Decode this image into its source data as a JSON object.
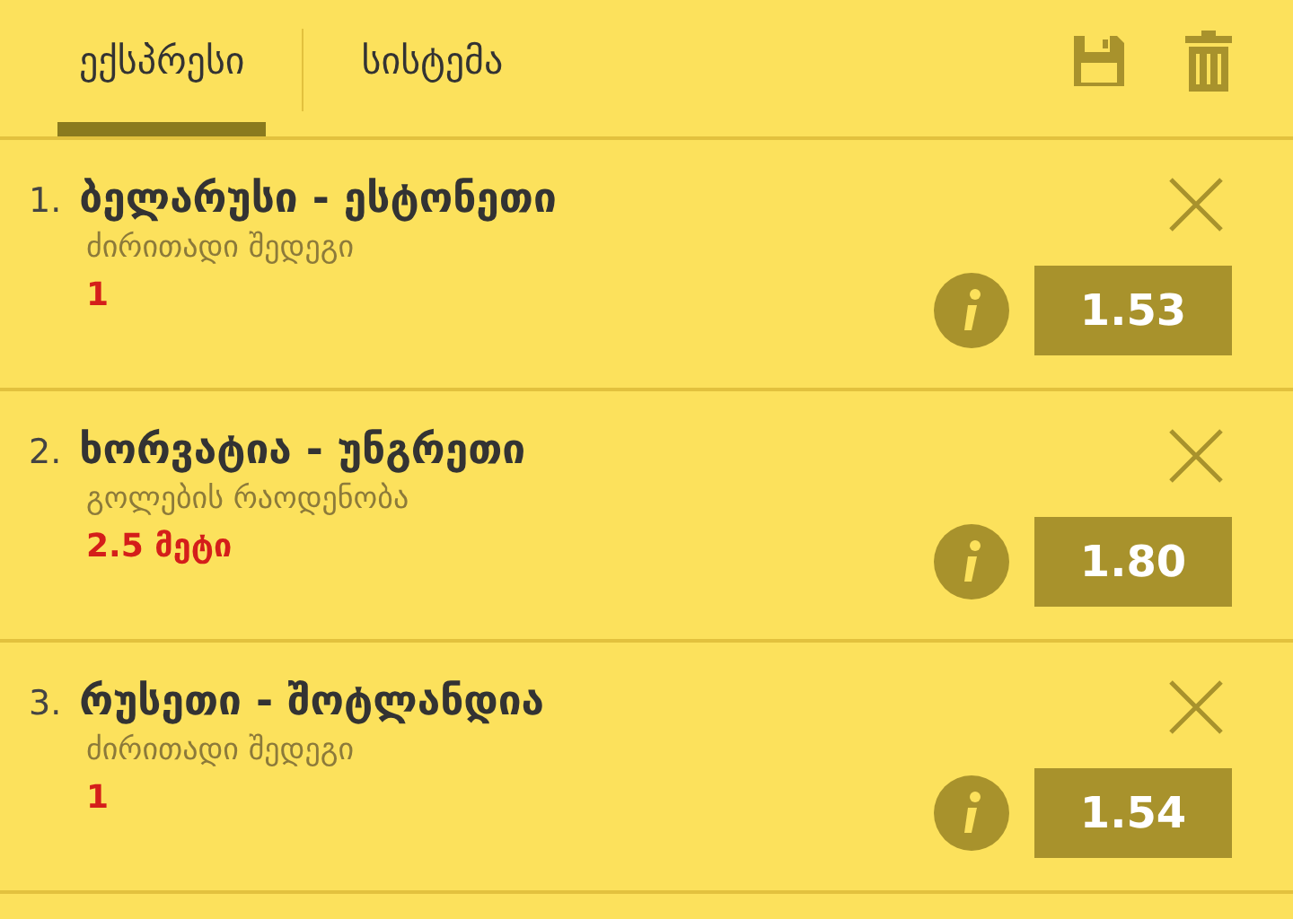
{
  "tabs": [
    {
      "label": "ექსპრესი",
      "selected": true
    },
    {
      "label": "სისტემა",
      "selected": false
    }
  ],
  "bets": [
    {
      "number": "1.",
      "match": "ბელარუსი - ესტონეთი",
      "market": "ძირითადი შედეგი",
      "pick": "1",
      "odds": "1.53"
    },
    {
      "number": "2.",
      "match": "ხორვატია - უნგრეთი",
      "market": "გოლების რაოდენობა",
      "pick": "2.5 მეტი",
      "odds": "1.80"
    },
    {
      "number": "3.",
      "match": "რუსეთი - შოტლანდია",
      "market": "ძირითადი შედეგი",
      "pick": "1",
      "odds": "1.54"
    }
  ]
}
